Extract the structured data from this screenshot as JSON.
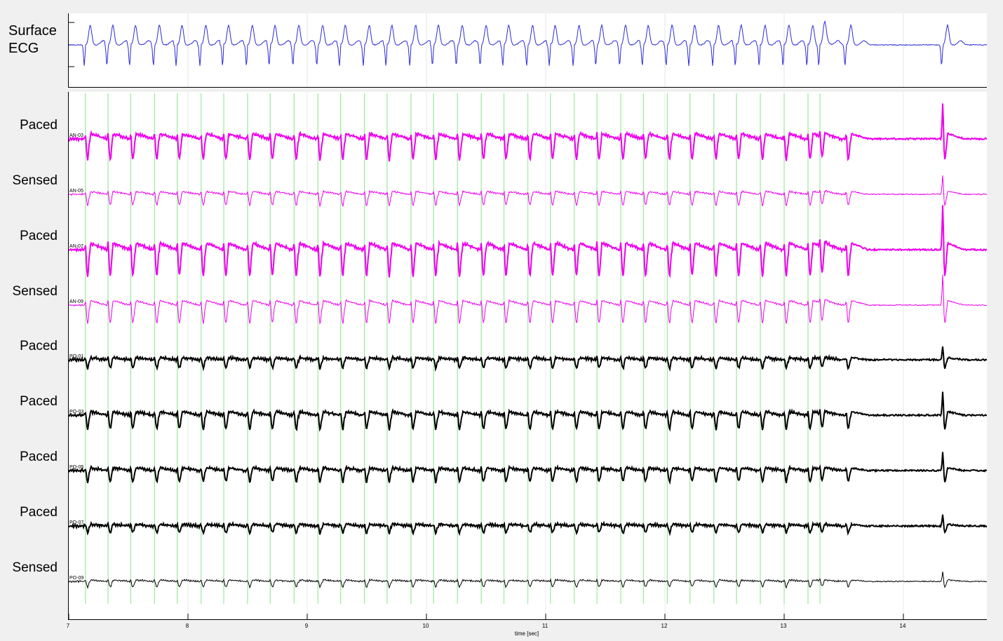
{
  "chart_data": {
    "type": "line",
    "title": "",
    "xlabel": "time [sec]",
    "ylabel": "",
    "xlim": [
      7,
      14.7
    ],
    "x_ticks": [
      "7",
      "8",
      "9",
      "10",
      "11",
      "12",
      "13",
      "14"
    ],
    "grid": true,
    "ecg": {
      "label_line1": "Surface",
      "label_line2": "ECG",
      "color": "#2b2bd8"
    },
    "pacing_markers": {
      "color": "#a6e8a6",
      "times": [
        7.14,
        7.33,
        7.52,
        7.72,
        7.91,
        8.11,
        8.3,
        8.5,
        8.69,
        8.89,
        9.09,
        9.28,
        9.48,
        9.67,
        9.87,
        10.06,
        10.26,
        10.46,
        10.65,
        10.85,
        11.04,
        11.24,
        11.43,
        11.63,
        11.82,
        12.02,
        12.21,
        12.41,
        12.6,
        12.8,
        13.0,
        13.2,
        13.3
      ]
    },
    "series": [
      {
        "name": "AN-03",
        "label": "Paced",
        "color": "#ee00ee",
        "width": 2.0
      },
      {
        "name": "AN-05",
        "label": "Sensed",
        "color": "#ee00ee",
        "width": 1.0
      },
      {
        "name": "AN-07",
        "label": "Paced",
        "color": "#ee00ee",
        "width": 2.0
      },
      {
        "name": "AN-09",
        "label": "Sensed",
        "color": "#ee00ee",
        "width": 1.0
      },
      {
        "name": "PO-01",
        "label": "Paced",
        "color": "#000000",
        "width": 2.0
      },
      {
        "name": "PO-03",
        "label": "Paced",
        "color": "#000000",
        "width": 2.0
      },
      {
        "name": "PO-05",
        "label": "Paced",
        "color": "#000000",
        "width": 2.0
      },
      {
        "name": "PO-07",
        "label": "Paced",
        "color": "#000000",
        "width": 2.0
      },
      {
        "name": "PO-09",
        "label": "Sensed",
        "color": "#000000",
        "width": 1.0
      }
    ]
  }
}
